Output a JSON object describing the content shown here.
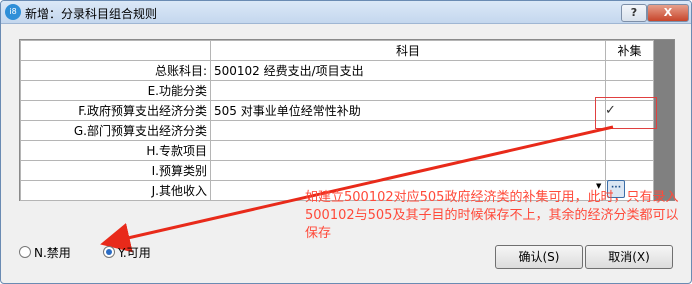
{
  "window": {
    "icon_text": "i8",
    "title": "新增：分录科目组合规则",
    "help_label": "?",
    "close_label": "X"
  },
  "grid": {
    "headers": [
      "",
      "科目",
      "补集"
    ],
    "rows": [
      {
        "label": "总账科目:",
        "value": "500102 经费支出/项目支出",
        "complement": ""
      },
      {
        "label": "E.功能分类",
        "value": "",
        "complement": ""
      },
      {
        "label": "F.政府预算支出经济分类",
        "value": "505 对事业单位经常性补助",
        "complement": "✓"
      },
      {
        "label": "G.部门预算支出经济分类",
        "value": "",
        "complement": ""
      },
      {
        "label": "H.专款项目",
        "value": "",
        "complement": ""
      },
      {
        "label": "I.预算类别",
        "value": "",
        "complement": ""
      },
      {
        "label": "J.其他收入",
        "value": "",
        "complement": ""
      }
    ],
    "ellipsis_label": "···",
    "dropdown_arrow": "▼"
  },
  "annotation": {
    "text": "如建立500102对应505政府经济类的补集可用，此时，只有录入500102与505及其子目的时候保存不上，其余的经济分类都可以保存",
    "color": "#ff4a3a"
  },
  "status_options": [
    {
      "label": "N.禁用",
      "selected": false
    },
    {
      "label": "Y.可用",
      "selected": true
    }
  ],
  "buttons": {
    "confirm": "确认(S)",
    "cancel": "取消(X)"
  }
}
